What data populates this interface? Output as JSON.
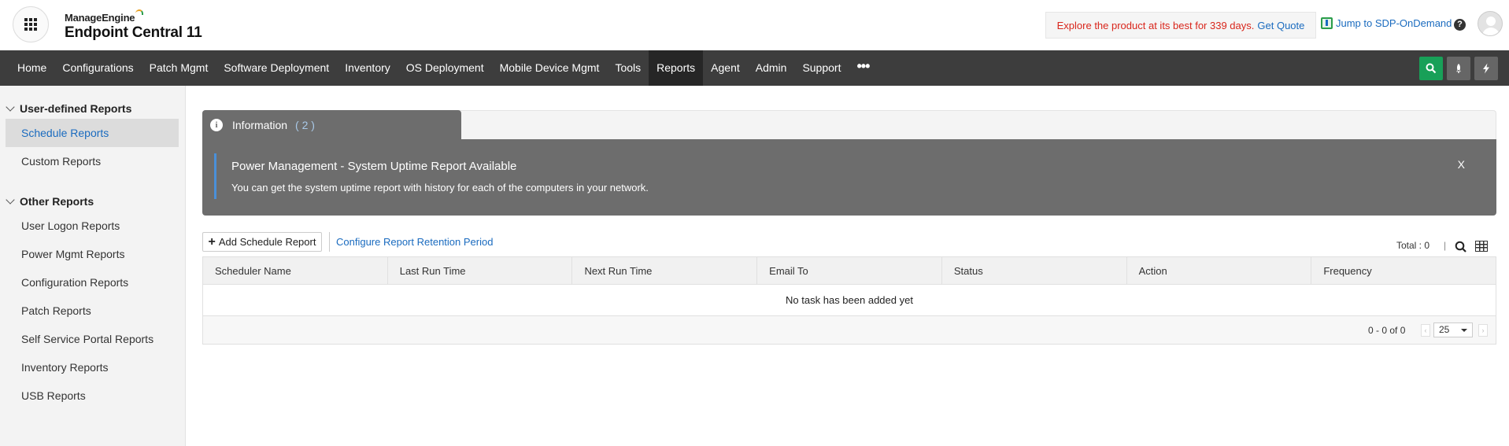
{
  "brand": {
    "company": "ManageEngine",
    "product": "Endpoint Central 11"
  },
  "promo": {
    "text": "Explore the product at its best for 339 days.",
    "link": "Get Quote"
  },
  "header": {
    "sdp_link": "Jump to SDP-OnDemand",
    "help_glyph": "?"
  },
  "nav": {
    "items": [
      "Home",
      "Configurations",
      "Patch Mgmt",
      "Software Deployment",
      "Inventory",
      "OS Deployment",
      "Mobile Device Mgmt",
      "Tools",
      "Reports",
      "Agent",
      "Admin",
      "Support"
    ],
    "active": "Reports",
    "more_glyph": "•••"
  },
  "sidebar": {
    "group1": "User-defined Reports",
    "group1_items": [
      "Schedule Reports",
      "Custom Reports"
    ],
    "group2": "Other Reports",
    "group2_items": [
      "User Logon Reports",
      "Power Mgmt Reports",
      "Configuration Reports",
      "Patch Reports",
      "Self Service Portal Reports",
      "Inventory Reports",
      "USB Reports"
    ],
    "active": "Schedule Reports"
  },
  "info": {
    "icon_glyph": "i",
    "tab_label": "Information",
    "count": "( 2 )",
    "title": "Power Management - System Uptime Report Available",
    "description": "You can get the system uptime report with history for each of the computers in your network.",
    "close": "X"
  },
  "toolbar": {
    "add_label": "Add Schedule Report",
    "add_glyph": "+",
    "retention_link": "Configure Report Retention Period",
    "total": "Total : 0",
    "total_sep": "|"
  },
  "table": {
    "columns": [
      "Scheduler Name",
      "Last Run Time",
      "Next Run Time",
      "Email To",
      "Status",
      "Action",
      "Frequency"
    ],
    "empty_message": "No task has been added yet",
    "range": "0 - 0 of 0",
    "page_size": "25",
    "prev_glyph": "‹",
    "next_glyph": "›"
  },
  "colors": {
    "nav_bg": "#3d3d3d",
    "accent_link": "#1a6bbf",
    "search_button": "#18a058",
    "promo_text": "#d9261c",
    "info_panel": "#6d6d6d"
  }
}
